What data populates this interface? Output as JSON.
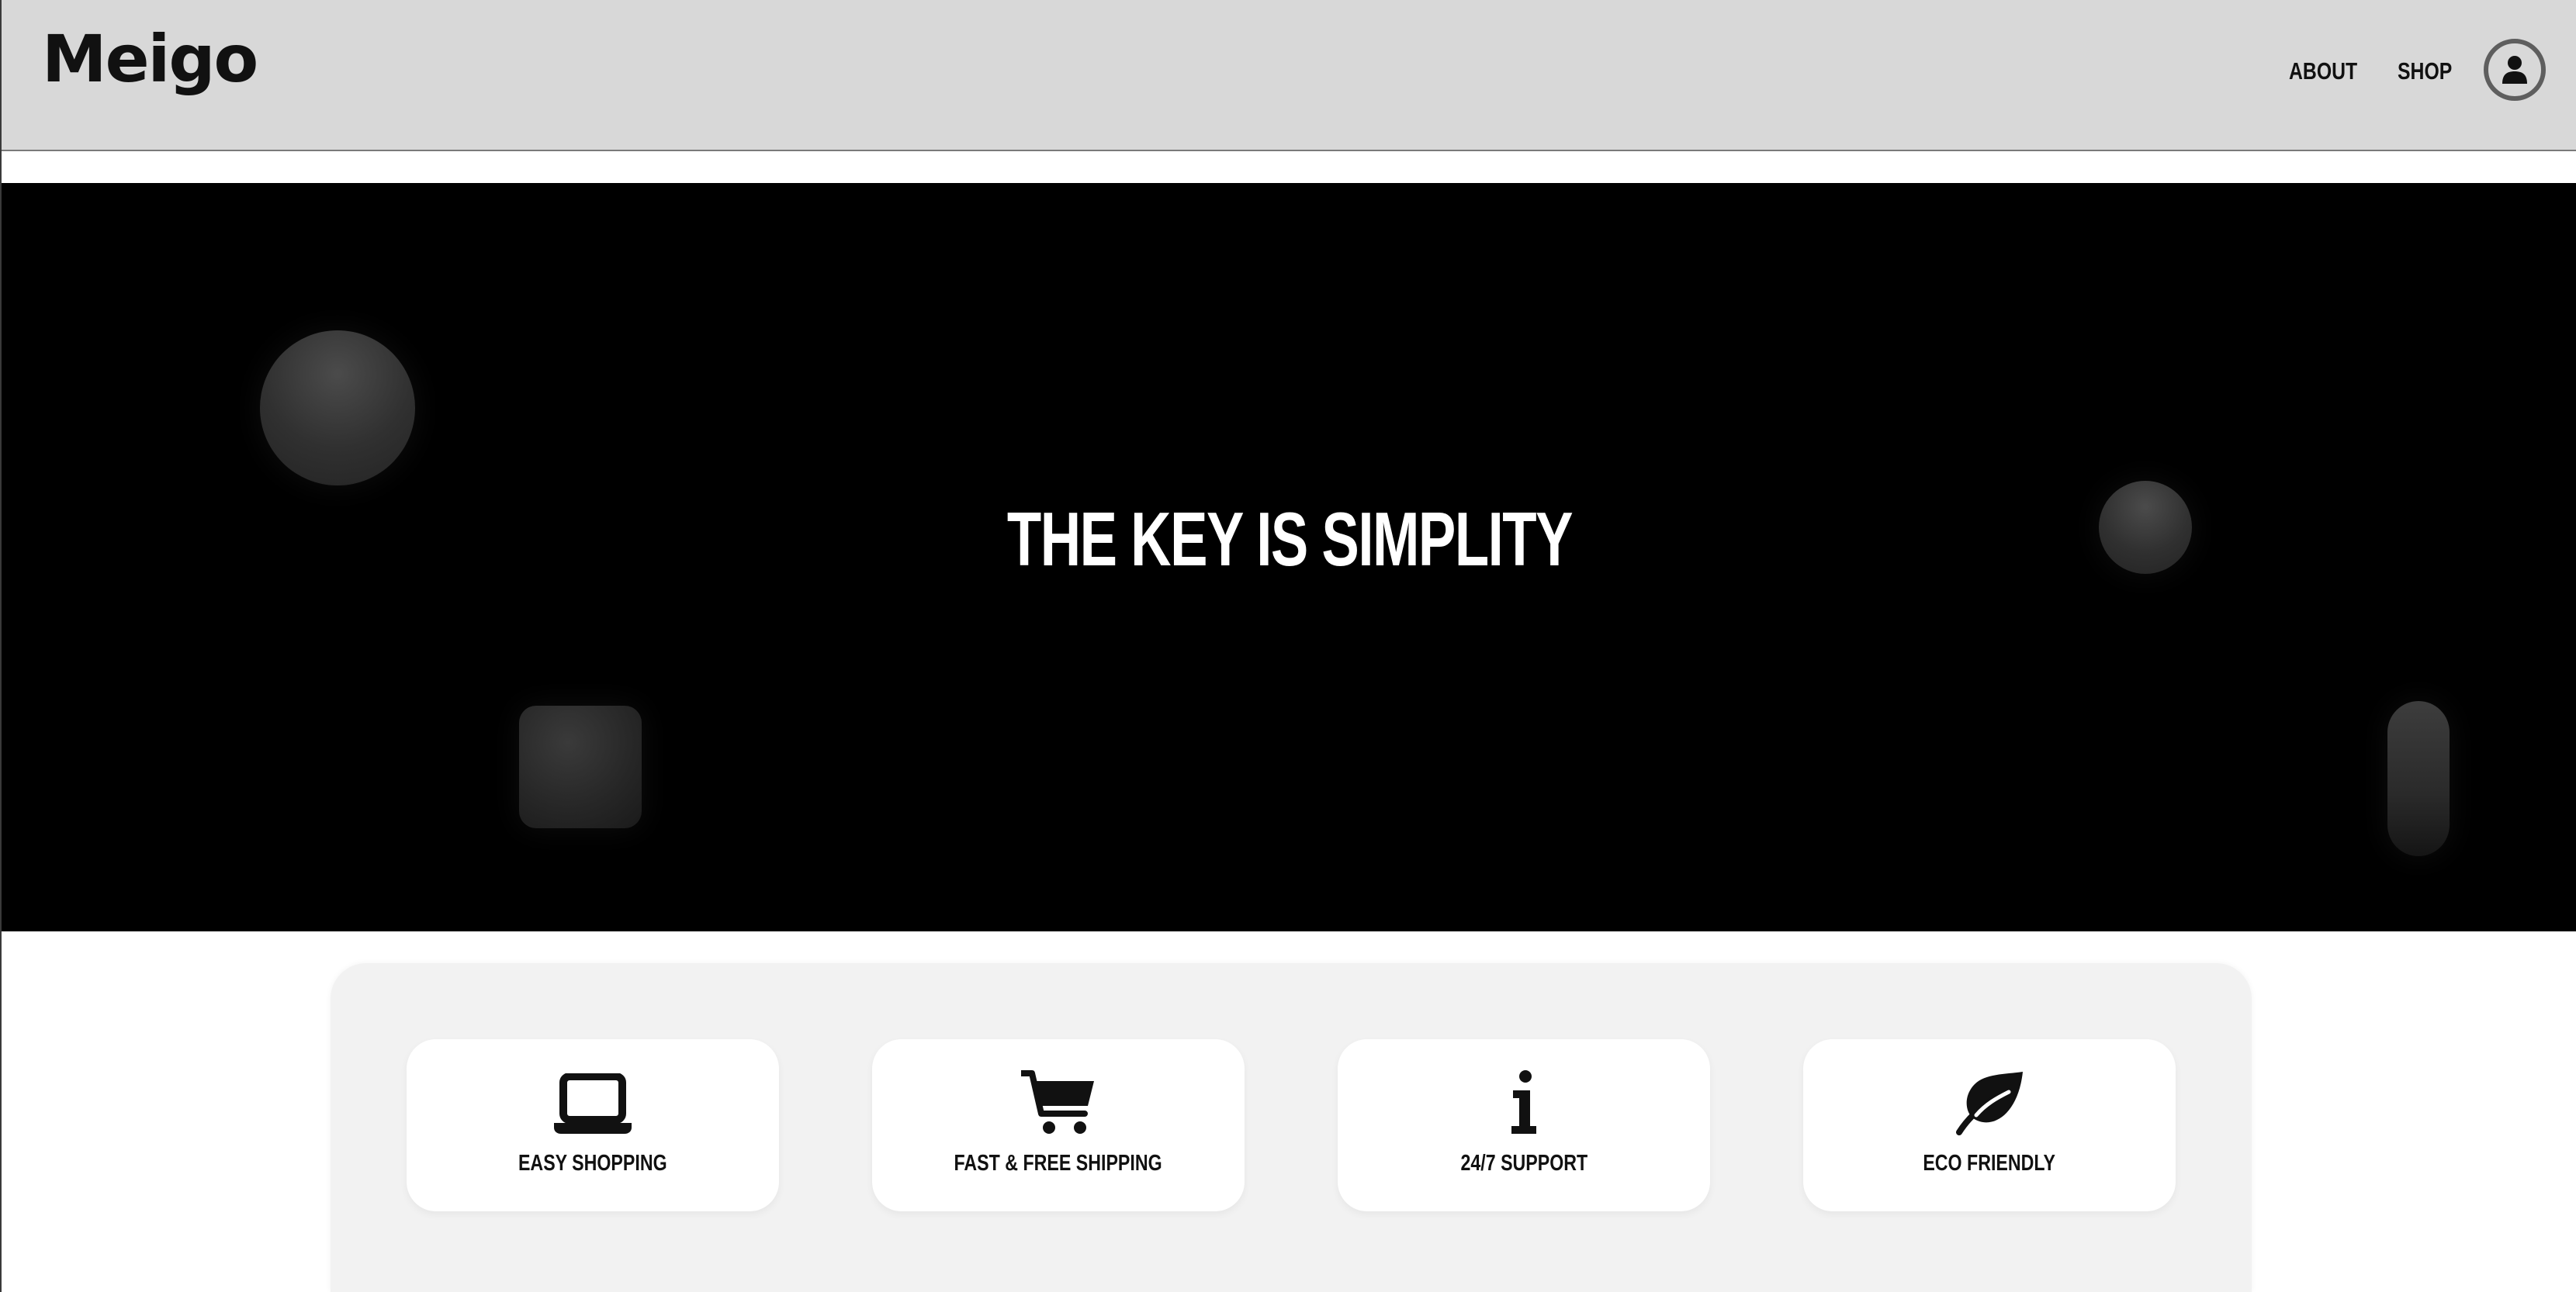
{
  "header": {
    "logo": "Meigo",
    "nav": {
      "about": "ABOUT",
      "shop": "SHOP"
    },
    "account_icon": "user-icon"
  },
  "hero": {
    "title": "THE KEY IS SIMPLITY",
    "background": "#000000"
  },
  "features": {
    "items": [
      {
        "label": "EASY SHOPPING",
        "icon": "laptop-icon"
      },
      {
        "label": "FAST & FREE SHIPPING",
        "icon": "cart-icon"
      },
      {
        "label": "24/7 SUPPORT",
        "icon": "info-icon"
      },
      {
        "label": "ECO FRIENDLY",
        "icon": "leaf-icon"
      }
    ]
  },
  "colors": {
    "header_bg": "#d8d8d8",
    "hero_bg": "#000000",
    "features_bg": "#f2f2f2",
    "text": "#111111"
  }
}
